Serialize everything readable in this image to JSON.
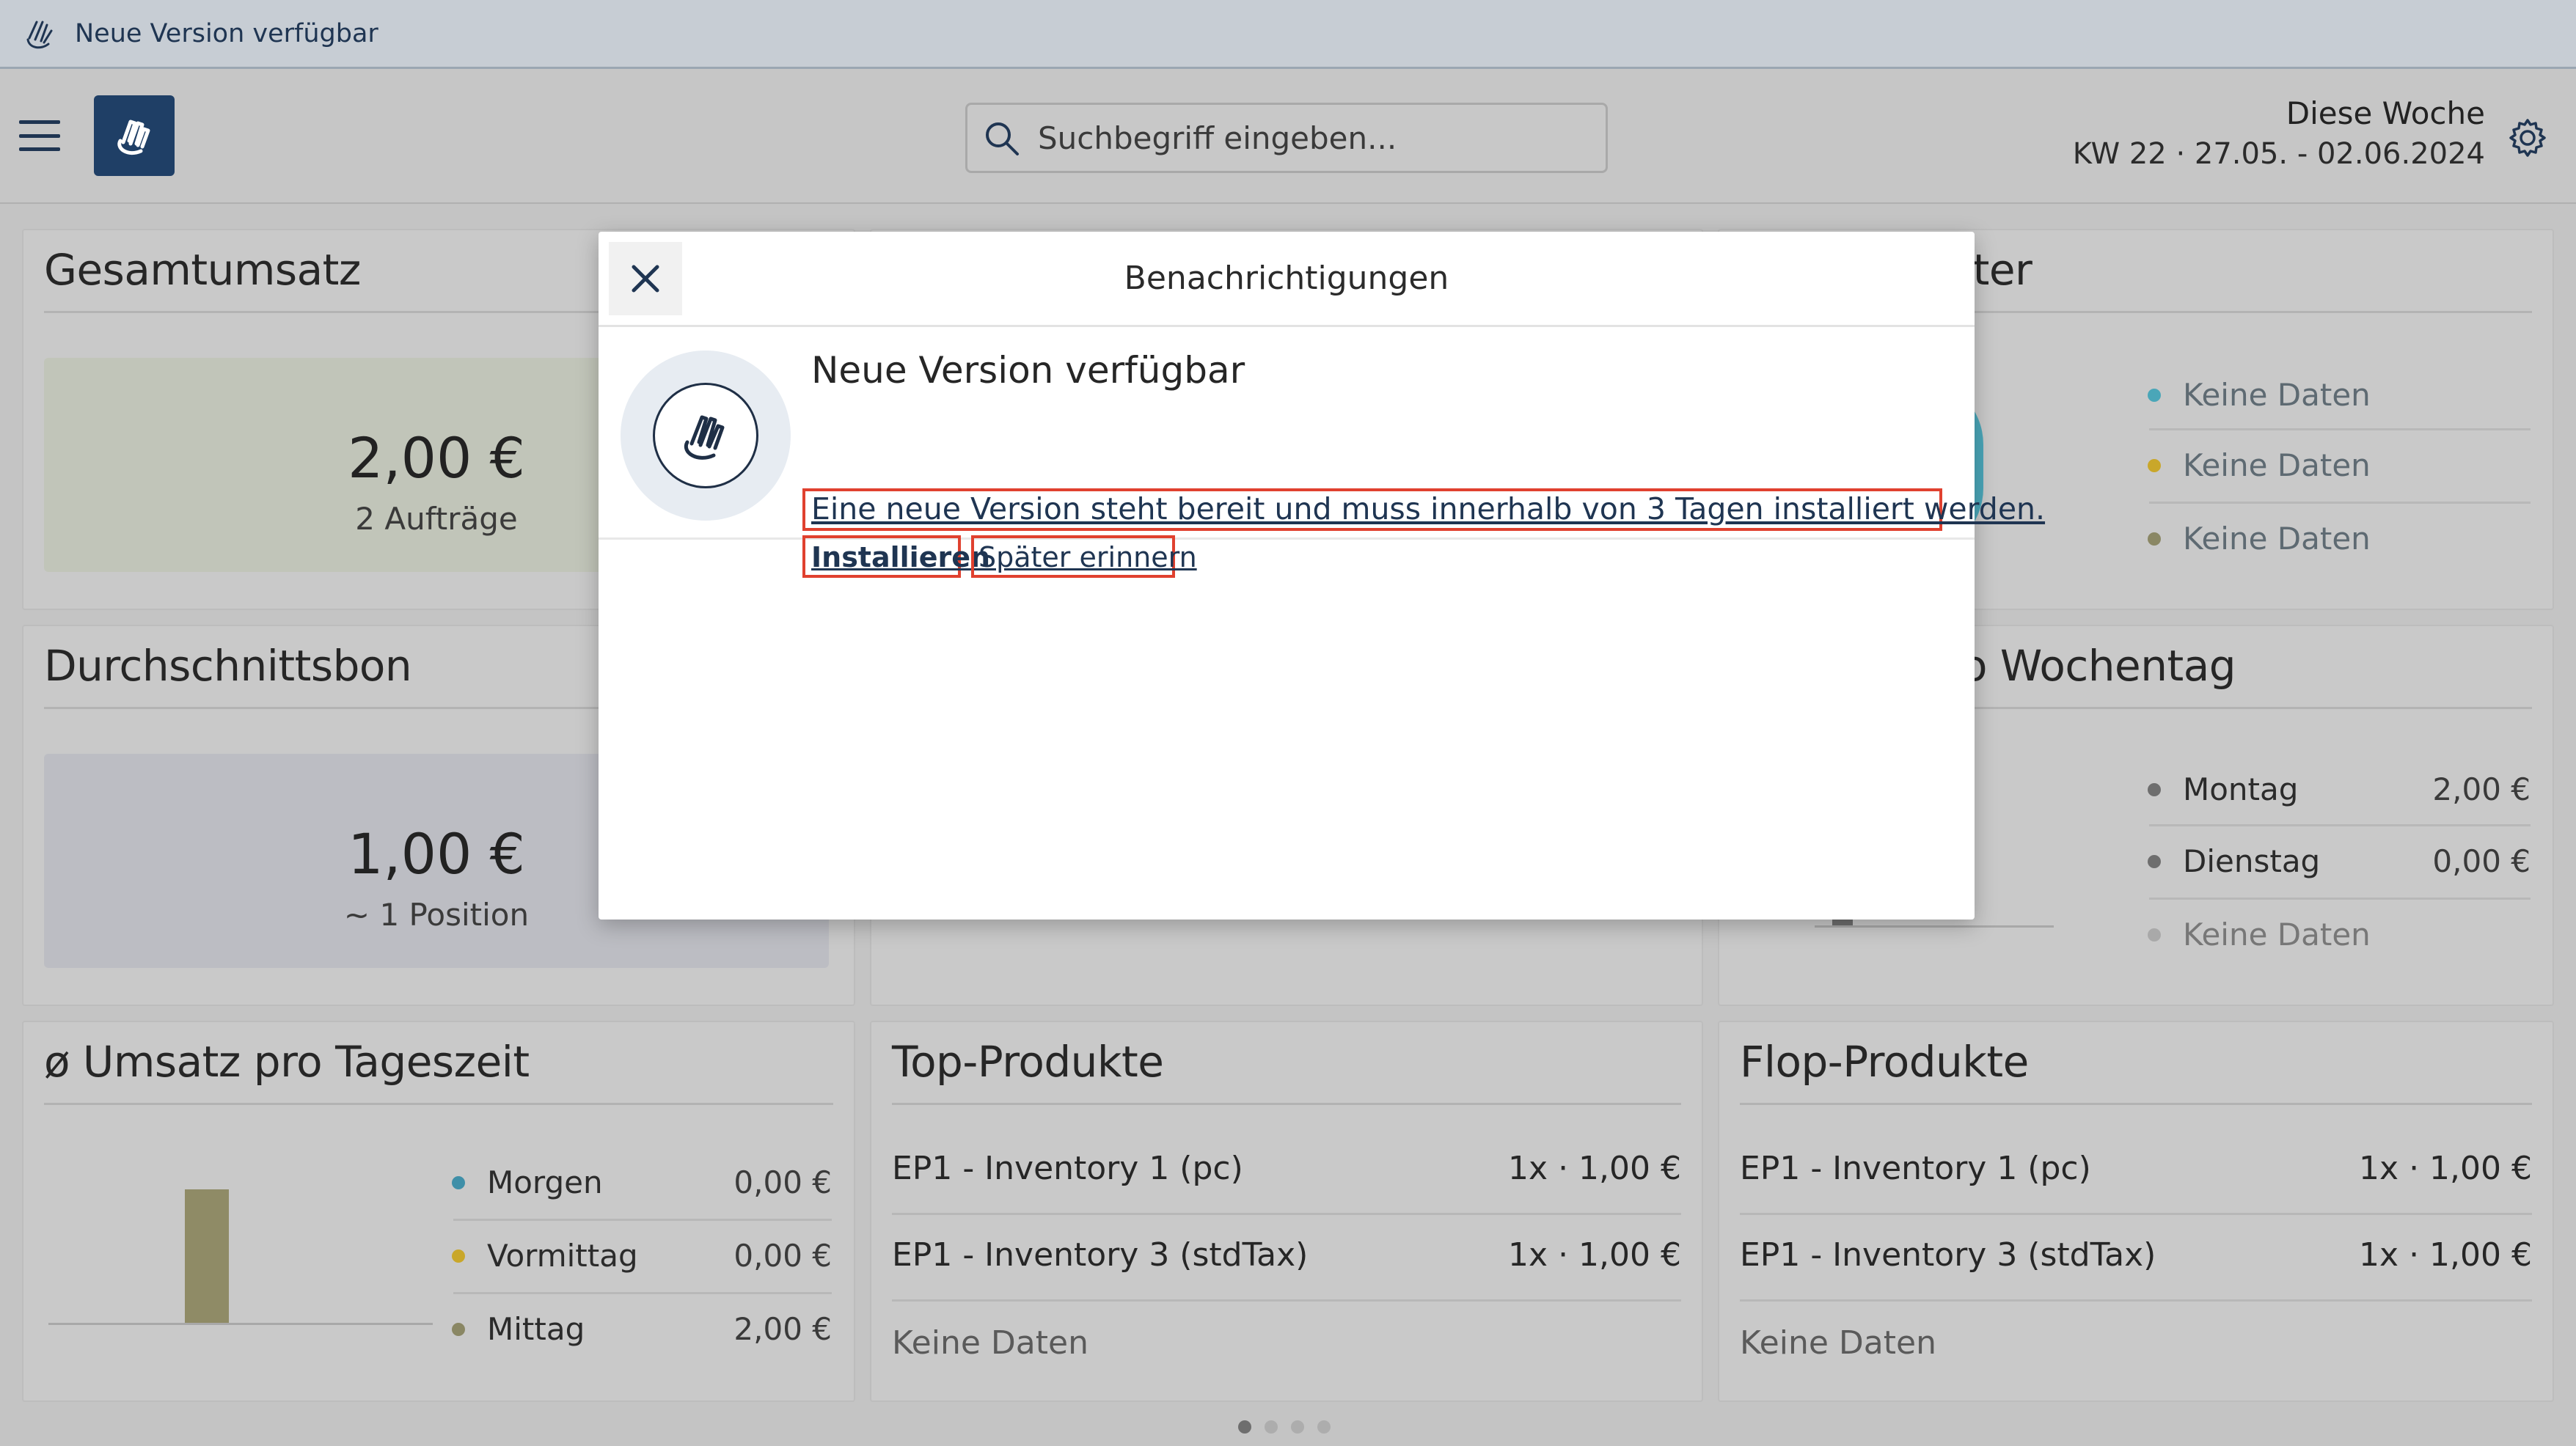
{
  "banner": {
    "text": "Neue Version verfügbar"
  },
  "header": {
    "search_placeholder": "Suchbegriff eingeben...",
    "week_label": "Diese Woche",
    "week_range": "KW 22 · 27.05. - 02.06.2024"
  },
  "cards": {
    "gesamtumsatz": {
      "title": "Gesamtumsatz",
      "value": "2,00 €",
      "sub": "2 Aufträge"
    },
    "durchschnittsbon": {
      "title": "Durchschnittsbon",
      "value": "1,00 €",
      "sub": "~ 1 Position"
    },
    "mitarbeiter": {
      "title_visible": "iter",
      "legend": [
        "Keine Daten",
        "Keine Daten",
        "Keine Daten"
      ]
    },
    "wochentag": {
      "title_visible": "o Wochentag",
      "legend": [
        {
          "label": "Montag",
          "value": "2,00 €"
        },
        {
          "label": "Dienstag",
          "value": "0,00 €"
        },
        {
          "label": "Keine Daten",
          "value": ""
        }
      ]
    },
    "tageszeit": {
      "title": "ø Umsatz pro Tageszeit",
      "legend": [
        {
          "label": "Morgen",
          "value": "0,00 €",
          "color": "#3f8fa8"
        },
        {
          "label": "Vormittag",
          "value": "0,00 €",
          "color": "#c9a72a"
        },
        {
          "label": "Mittag",
          "value": "2,00 €",
          "color": "#8a8764"
        }
      ]
    },
    "top": {
      "title": "Top-Produkte",
      "rows": [
        {
          "name": "EP1 - Inventory 1 (pc)",
          "value": "1x · 1,00 €"
        },
        {
          "name": "EP1 - Inventory 3 (stdTax)",
          "value": "1x · 1,00 €"
        },
        {
          "name": "Keine Daten",
          "value": ""
        }
      ]
    },
    "flop": {
      "title": "Flop-Produkte",
      "rows": [
        {
          "name": "EP1 - Inventory 1 (pc)",
          "value": "1x · 1,00 €"
        },
        {
          "name": "EP1 - Inventory 3 (stdTax)",
          "value": "1x · 1,00 €"
        },
        {
          "name": "Keine Daten",
          "value": ""
        }
      ]
    }
  },
  "modal": {
    "title": "Benachrichtigungen",
    "notification": {
      "title": "Neue Version verfügbar",
      "description": "Eine neue Version steht bereit und muss innerhalb von 3 Tagen installiert werden.",
      "install_label": "Installieren",
      "remind_label": "Später erinnern"
    }
  },
  "colors": {
    "accent": "#1f3f66",
    "highlight_box": "#e0412f",
    "teal": "#4aa6b8",
    "yellow": "#c9a72a",
    "olive": "#8a8764"
  },
  "pager": {
    "pages": 4,
    "active": 1
  }
}
